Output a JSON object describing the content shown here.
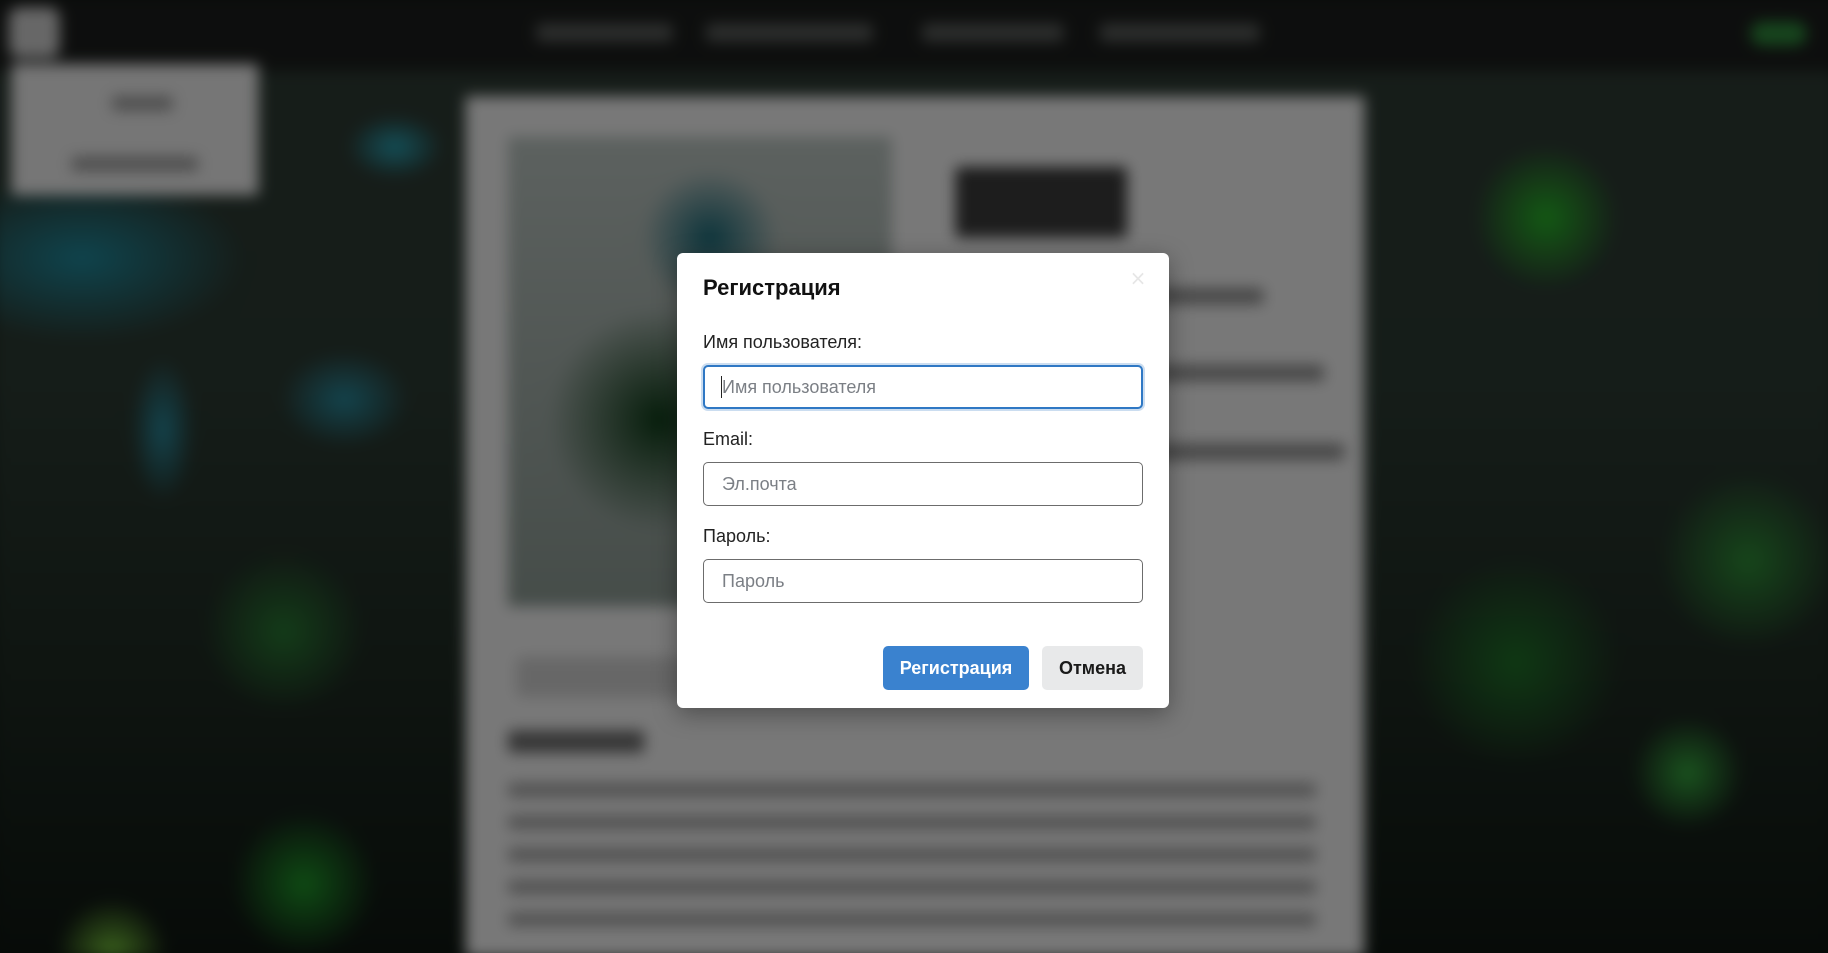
{
  "modal": {
    "title": "Регистрация",
    "close_symbol": "×",
    "fields": {
      "username": {
        "label": "Имя пользователя:",
        "placeholder": "Имя пользователя",
        "value": ""
      },
      "email": {
        "label": "Email:",
        "placeholder": "Эл.почта",
        "value": ""
      },
      "password": {
        "label": "Пароль:",
        "placeholder": "Пароль",
        "value": ""
      }
    },
    "buttons": {
      "submit_label": "Регистрация",
      "cancel_label": "Отмена"
    }
  },
  "colors": {
    "primary": "#3a82cf",
    "focus_border": "#2f78c4",
    "overlay": "rgba(0,0,0,0.5)",
    "cancel_bg": "#e8e9ea"
  },
  "icons": {
    "close": "close-icon"
  }
}
